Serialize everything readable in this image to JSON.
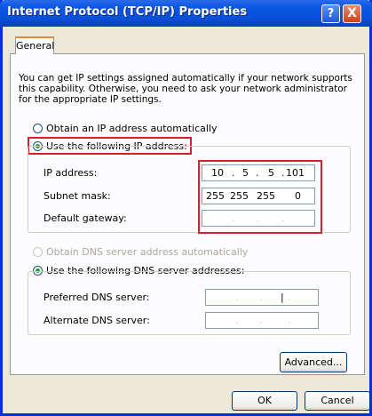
{
  "window": {
    "title": "Internet Protocol (TCP/IP) Properties",
    "help": "?",
    "close": "X"
  },
  "tabs": {
    "general": "General"
  },
  "description": "You can get IP settings assigned automatically if your network supports this capability. Otherwise, you need to ask your network administrator for the appropriate IP settings.",
  "ip_mode": {
    "auto_label": "Obtain an IP address automatically",
    "manual_label": "Use the following IP address:",
    "selected": "manual"
  },
  "ip_fields": {
    "ip_label": "IP address:",
    "ip_octets": [
      "10",
      "5",
      "5",
      "101"
    ],
    "subnet_label": "Subnet mask:",
    "subnet_octets": [
      "255",
      "255",
      "255",
      "0"
    ],
    "gateway_label": "Default gateway:",
    "gateway_octets": [
      "",
      "",
      "",
      ""
    ]
  },
  "dns_mode": {
    "auto_label": "Obtain DNS server address automatically",
    "manual_label": "Use the following DNS server addresses:",
    "selected": "manual"
  },
  "dns_fields": {
    "preferred_label": "Preferred DNS server:",
    "alternate_label": "Alternate DNS server:"
  },
  "buttons": {
    "advanced": "Advanced...",
    "ok": "OK",
    "cancel": "Cancel"
  },
  "colors": {
    "highlight": "#d9202a",
    "titlebar": "#0a55e4"
  }
}
